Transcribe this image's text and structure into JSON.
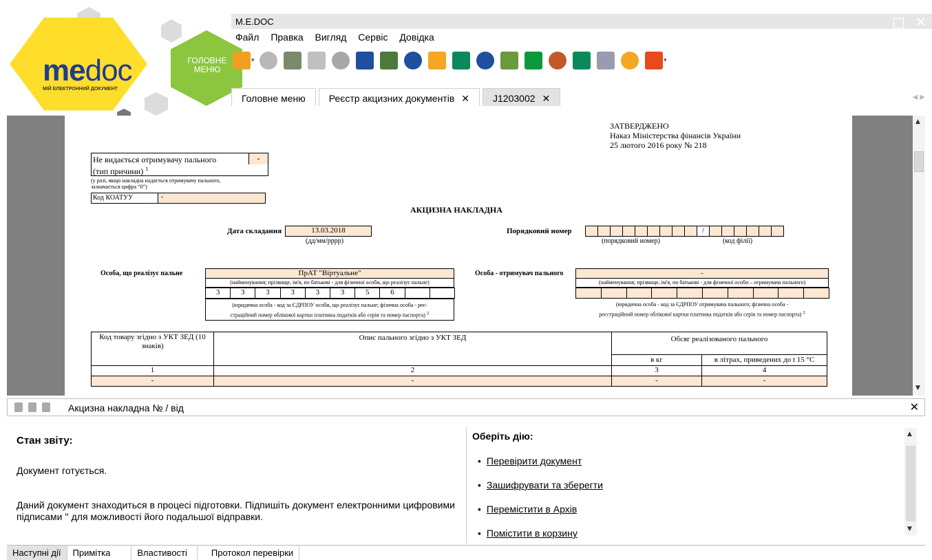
{
  "app": {
    "title": "M.E.DOC",
    "logo_me": "me",
    "logo_doc": "doc",
    "logo_sub": "МІЙ ЕЛЕКТРОННИЙ ДОКУМЕНТ",
    "main_menu_hex": "ГОЛОВНЕ МЕНЮ",
    "window_controls": {
      "minimize": "_",
      "maximize": "□",
      "close": "✕"
    }
  },
  "menu": {
    "items": [
      "Файл",
      "Правка",
      "Вигляд",
      "Сервіс",
      "Довідка"
    ]
  },
  "toolbar": {
    "icons": [
      {
        "name": "new-document-icon",
        "color": "#f0a020"
      },
      {
        "name": "delete-document-icon",
        "color": "#b8b8b8"
      },
      {
        "name": "document-list-icon",
        "color": "#7a8a6a"
      },
      {
        "name": "print-preview-icon",
        "color": "#c0c0c0"
      },
      {
        "name": "settings-icon",
        "color": "#a8a8a8"
      },
      {
        "name": "save-icon",
        "color": "#1e4fa0"
      },
      {
        "name": "report-icon",
        "color": "#4b7a3a"
      },
      {
        "name": "print-icon",
        "color": "#1e4fa0"
      },
      {
        "name": "send-icon",
        "color": "#f5a623"
      },
      {
        "name": "sign-icon",
        "color": "#0a8a5a"
      },
      {
        "name": "search-icon",
        "color": "#1e4fa0"
      },
      {
        "name": "check-icon",
        "color": "#6a9a3a"
      },
      {
        "name": "refresh-icon",
        "color": "#0a9a3a"
      },
      {
        "name": "archive-icon",
        "color": "#c05a2a"
      },
      {
        "name": "shield-icon",
        "color": "#0a8a5a"
      },
      {
        "name": "certificate-icon",
        "color": "#9a9ab0"
      },
      {
        "name": "help-icon",
        "color": "#f5a623"
      },
      {
        "name": "chat-icon",
        "color": "#e84a1a"
      }
    ]
  },
  "tabs": [
    {
      "label": "Головне меню",
      "close": ""
    },
    {
      "label": "Реєстр акцизних документів",
      "close": "✕"
    },
    {
      "label": "J1203002",
      "close": "✕"
    }
  ],
  "document": {
    "approved": "ЗАТВЕРДЖЕНО",
    "order": "Наказ Міністерства фінансів України",
    "order_date": "25 лютого 2016 року  № 218",
    "not_issued_label": "Не видається отримувачу пального",
    "reason_type_label": "(тип причини)",
    "reason_sup": "1",
    "reason_value": "-",
    "reason_note1": "(у разі, якщо накладна  надається отримувачу пального,",
    "reason_note2": "зазначається цифра “0”)",
    "koatuu_label": "Код КОАТУУ",
    "koatuu_value": "-",
    "heading": "АКЦИЗНА НАКЛАДНА",
    "date_label": "Дата складання",
    "date_value": "13.03.2018",
    "date_format": "(дд/мм/рррр)",
    "serial_label": "Порядковий номер",
    "serial_slash": "/",
    "serial_note": "(порядковий номер)",
    "branch_note": "(код філії)",
    "seller_label": "Особа, що реалізує пальне",
    "seller_name": "ПрАТ \"Віртуальне\"",
    "seller_name_note": "(найменування; прізвище, ім'я, по батькові - для фізичної особи, що реалізує пальне)",
    "seller_code": [
      "3",
      "3",
      "3",
      "3",
      "3",
      "3",
      "5",
      "6",
      "",
      ""
    ],
    "seller_code_note1": "(юридична особа - код за ЄДРПОУ особи, що реалізує пальне; фізична особа - реє-",
    "seller_code_note2": "страційний номер облікової картки платника податків або серія та номер паспорта)",
    "seller_code_sup": "2",
    "buyer_label": "Особа - отримувач пального",
    "buyer_name": "-",
    "buyer_name_note": "(найменування; прізвище, ім'я, по батькові - для фізичної особи – отримувача пального)",
    "buyer_code_note1": "(юридична особа - код за ЄДРПОУ отримувача пального;  фізична особа -",
    "buyer_code_note2": "реєстраційний номер облікової картки платника податків або серія та номер паспорта)",
    "buyer_code_sup": "2",
    "table": {
      "col1": "Код товару згідно з УКТ ЗЕД (10 знаків)",
      "col2": "Опис пального згідно з УКТ ЗЕД",
      "col3": "Обсяг реалізованого пального",
      "col3a": "в кг",
      "col3b": "в літрах, приведених до t 15  °С",
      "nums": [
        "1",
        "2",
        "3",
        "4"
      ],
      "row": [
        "-",
        "-",
        "-",
        "-"
      ]
    }
  },
  "panel": {
    "title": "Акцизна накладна  № /  від",
    "close": "✕",
    "status_heading": "Стан звіту:",
    "status_text": "Документ готується.",
    "status_desc": "Даний документ знаходиться в процесі підготовки. Підпишіть документ електронними цифровими підписами '' для можливості його подальшої відправки.",
    "actions_heading": "Оберіть дію:",
    "actions": [
      "Перевірити документ",
      "Зашифрувати та зберегти",
      "Перемістити в Архів",
      "Помістити в корзину"
    ]
  },
  "bottom_tabs": [
    "Наступні дії",
    "Примітка",
    "Властивості",
    "Протокол перевірки"
  ]
}
